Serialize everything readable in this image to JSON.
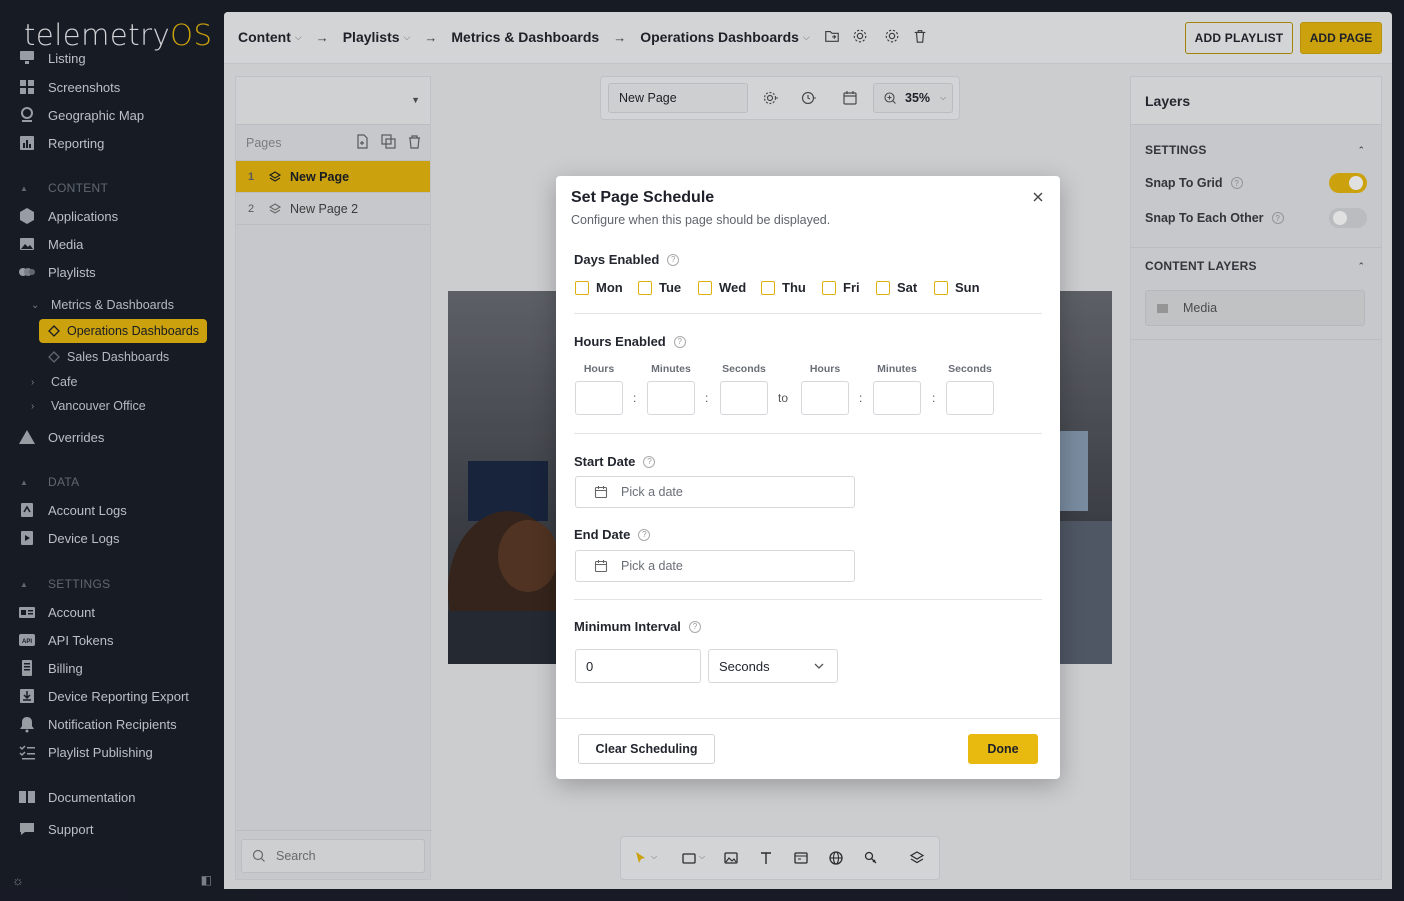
{
  "brand": {
    "logo_main": "telemetry",
    "logo_accent": "OS",
    "accent_color": "#e8b90f"
  },
  "sidebar": {
    "top_items": [
      {
        "label": "Listing",
        "icon": "monitor-icon"
      },
      {
        "label": "Screenshots",
        "icon": "grid-icon"
      },
      {
        "label": "Geographic Map",
        "icon": "map-pin-icon"
      },
      {
        "label": "Reporting",
        "icon": "bar-chart-icon"
      }
    ],
    "content_header": "CONTENT",
    "content_items": [
      {
        "label": "Applications",
        "icon": "box-icon"
      },
      {
        "label": "Media",
        "icon": "image-icon"
      },
      {
        "label": "Playlists",
        "icon": "playlist-icon"
      }
    ],
    "tree": {
      "metrics": "Metrics & Dashboards",
      "operations": "Operations Dashboards",
      "sales": "Sales Dashboards",
      "cafe": "Cafe",
      "vancouver": "Vancouver Office"
    },
    "overrides": "Overrides",
    "data_header": "DATA",
    "data_items": [
      {
        "label": "Account Logs",
        "icon": "log-icon"
      },
      {
        "label": "Device Logs",
        "icon": "device-log-icon"
      }
    ],
    "settings_header": "SETTINGS",
    "settings_items": [
      {
        "label": "Account",
        "icon": "id-card-icon"
      },
      {
        "label": "API Tokens",
        "icon": "api-icon"
      },
      {
        "label": "Billing",
        "icon": "receipt-icon"
      },
      {
        "label": "Device Reporting Export",
        "icon": "download-icon"
      },
      {
        "label": "Notification Recipients",
        "icon": "bell-icon"
      },
      {
        "label": "Playlist Publishing",
        "icon": "checklist-icon"
      }
    ],
    "documentation": "Documentation",
    "support": "Support"
  },
  "breadcrumb": {
    "content": "Content",
    "playlists": "Playlists",
    "metrics": "Metrics & Dashboards",
    "operations": "Operations Dashboards"
  },
  "header_buttons": {
    "add_playlist": "ADD PLAYLIST",
    "add_page": "ADD PAGE"
  },
  "pages": {
    "header": "Pages",
    "items": [
      {
        "num": "1",
        "label": "New Page",
        "active": true
      },
      {
        "num": "2",
        "label": "New Page 2",
        "active": false
      }
    ],
    "search_placeholder": "Search"
  },
  "canvas_toolbar": {
    "page_name": "New Page",
    "zoom": "35%"
  },
  "layers": {
    "title": "Layers",
    "settings_header": "SETTINGS",
    "snap_to_grid": "Snap To Grid",
    "snap_to_grid_on": true,
    "snap_to_each_other": "Snap To Each Other",
    "snap_to_each_other_on": false,
    "content_layers_header": "CONTENT LAYERS",
    "content_layers": [
      "Media"
    ]
  },
  "modal": {
    "title": "Set Page Schedule",
    "subtitle": "Configure when this page should be displayed.",
    "days_label": "Days Enabled",
    "days": [
      "Mon",
      "Tue",
      "Wed",
      "Thu",
      "Fri",
      "Sat",
      "Sun"
    ],
    "hours_label": "Hours Enabled",
    "time_cols": [
      "Hours",
      "Minutes",
      "Seconds",
      "Hours",
      "Minutes",
      "Seconds"
    ],
    "to_label": "to",
    "start_date_label": "Start Date",
    "start_date_placeholder": "Pick a date",
    "end_date_label": "End Date",
    "end_date_placeholder": "Pick a date",
    "min_interval_label": "Minimum Interval",
    "min_interval_value": "0",
    "min_interval_unit": "Seconds",
    "clear_button": "Clear Scheduling",
    "done_button": "Done"
  }
}
